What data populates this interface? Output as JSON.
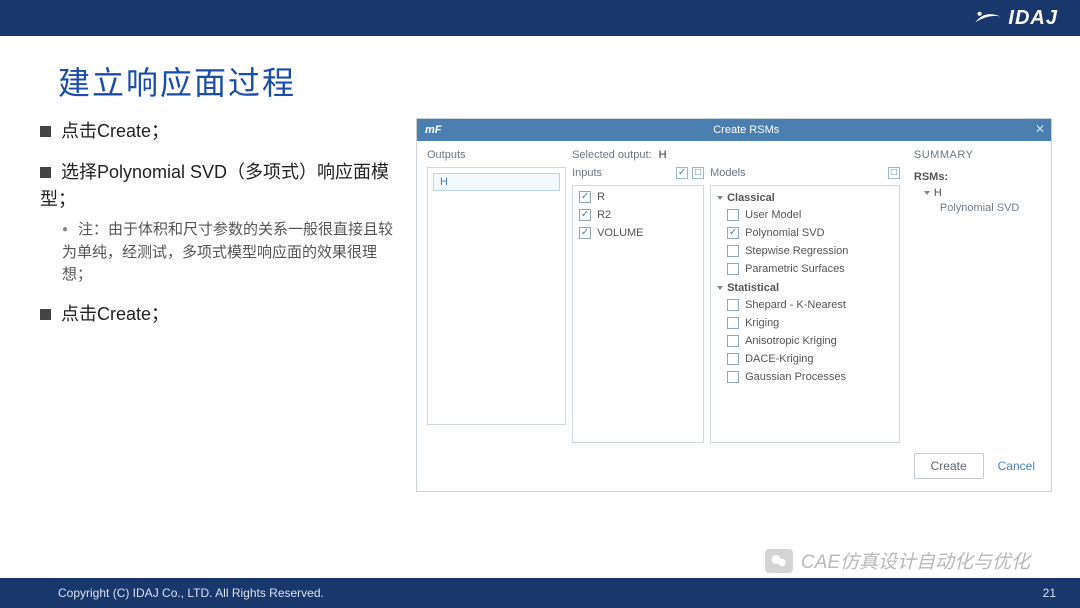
{
  "brand": "IDAJ",
  "slide_title": "建立响应面过程",
  "bullets": {
    "b1": "点击Create；",
    "b2": "选择Polynomial SVD（多项式）响应面模型；",
    "b2_note": "注：由于体积和尺寸参数的关系一般很直接且较为单纯，经测试，多项式模型响应面的效果很理想；",
    "b3": "点击Create；"
  },
  "dialog": {
    "title": "Create RSMs",
    "outputs_label": "Outputs",
    "outputs": [
      "H"
    ],
    "selected_output_label": "Selected output:",
    "selected_output_value": "H",
    "inputs_label": "Inputs",
    "inputs": [
      {
        "name": "R",
        "checked": true
      },
      {
        "name": "R2",
        "checked": true
      },
      {
        "name": "VOLUME",
        "checked": true
      }
    ],
    "models_label": "Models",
    "model_groups": [
      {
        "name": "Classical",
        "items": [
          {
            "name": "User Model",
            "checked": false
          },
          {
            "name": "Polynomial SVD",
            "checked": true
          },
          {
            "name": "Stepwise Regression",
            "checked": false
          },
          {
            "name": "Parametric Surfaces",
            "checked": false
          }
        ]
      },
      {
        "name": "Statistical",
        "items": [
          {
            "name": "Shepard - K-Nearest",
            "checked": false
          },
          {
            "name": "Kriging",
            "checked": false
          },
          {
            "name": "Anisotropic Kriging",
            "checked": false
          },
          {
            "name": "DACE-Kriging",
            "checked": false
          },
          {
            "name": "Gaussian Processes",
            "checked": false
          }
        ]
      }
    ],
    "summary_label": "SUMMARY",
    "summary_rsms_label": "RSMs:",
    "summary_items": [
      {
        "name": "H",
        "children": [
          "Polynomial SVD"
        ]
      }
    ],
    "create_btn": "Create",
    "cancel_btn": "Cancel"
  },
  "footer_copyright": "Copyright (C)  IDAJ Co., LTD.  All Rights Reserved.",
  "page_number": "21",
  "wechat_tag": "CAE仿真设计自动化与优化"
}
